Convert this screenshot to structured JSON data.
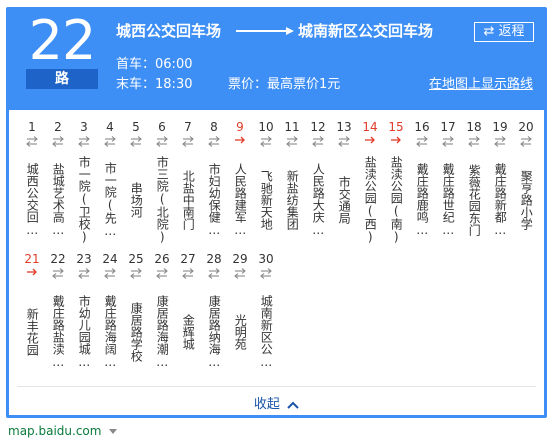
{
  "route": {
    "number": "22",
    "suffix": "路"
  },
  "terminals": {
    "from": "城西公交回车场",
    "to": "城南新区公交回车场"
  },
  "return_button": {
    "icon": "swap-icon",
    "label": "⇄ 返程"
  },
  "schedule": {
    "first_label": "首车：",
    "first_time": "06:00",
    "last_label": "末车：",
    "last_time": "18:30",
    "fare": "票价：最高票价1元"
  },
  "map_link": "在地图上显示路线",
  "stops": [
    {
      "num": "1",
      "name": "城西公交回…",
      "transfer": false
    },
    {
      "num": "2",
      "name": "盐城艺术高…",
      "transfer": false
    },
    {
      "num": "3",
      "name": "市一院(卫校)",
      "transfer": false
    },
    {
      "num": "4",
      "name": "市一院(先…",
      "transfer": false
    },
    {
      "num": "5",
      "name": "串场河",
      "transfer": false
    },
    {
      "num": "6",
      "name": "市三院(北院)",
      "transfer": false
    },
    {
      "num": "7",
      "name": "北盐中南门",
      "transfer": false
    },
    {
      "num": "8",
      "name": "市妇幼保健…",
      "transfer": false
    },
    {
      "num": "9",
      "name": "人民路建军…",
      "transfer": true
    },
    {
      "num": "10",
      "name": "飞驰新天地",
      "transfer": false
    },
    {
      "num": "11",
      "name": "新盐纺集团",
      "transfer": false
    },
    {
      "num": "12",
      "name": "人民路大庆…",
      "transfer": false
    },
    {
      "num": "13",
      "name": "市交通局",
      "transfer": false
    },
    {
      "num": "14",
      "name": "盐渎公园(西)",
      "transfer": true
    },
    {
      "num": "15",
      "name": "盐渎公园(南)",
      "transfer": true
    },
    {
      "num": "16",
      "name": "戴庄路鹿鸣…",
      "transfer": false
    },
    {
      "num": "17",
      "name": "戴庄路世纪…",
      "transfer": false
    },
    {
      "num": "18",
      "name": "紫薇花园东门",
      "transfer": false
    },
    {
      "num": "19",
      "name": "戴庄路新都…",
      "transfer": false
    },
    {
      "num": "20",
      "name": "聚亨路小学",
      "transfer": false
    },
    {
      "num": "21",
      "name": "新丰花园",
      "transfer": true
    },
    {
      "num": "22",
      "name": "戴庄路盐渎…",
      "transfer": false
    },
    {
      "num": "23",
      "name": "市幼儿园城…",
      "transfer": false
    },
    {
      "num": "24",
      "name": "戴庄路海阔…",
      "transfer": false
    },
    {
      "num": "25",
      "name": "康居路学校",
      "transfer": false
    },
    {
      "num": "26",
      "name": "康居路海潮…",
      "transfer": false
    },
    {
      "num": "27",
      "name": "金辉城",
      "transfer": false
    },
    {
      "num": "28",
      "name": "康居路纳海…",
      "transfer": false
    },
    {
      "num": "29",
      "name": "光明苑",
      "transfer": false
    },
    {
      "num": "30",
      "name": "城南新区公…",
      "transfer": false
    }
  ],
  "collapse_label": "收起",
  "footer": {
    "site": "map.baidu.com"
  },
  "colors": {
    "header_blue": "#3d8ef5",
    "badge_blue": "#1e64c8",
    "transfer_red": "#e03b2b",
    "link_blue": "#1a55a8",
    "footer_green": "#0a7a3a"
  }
}
